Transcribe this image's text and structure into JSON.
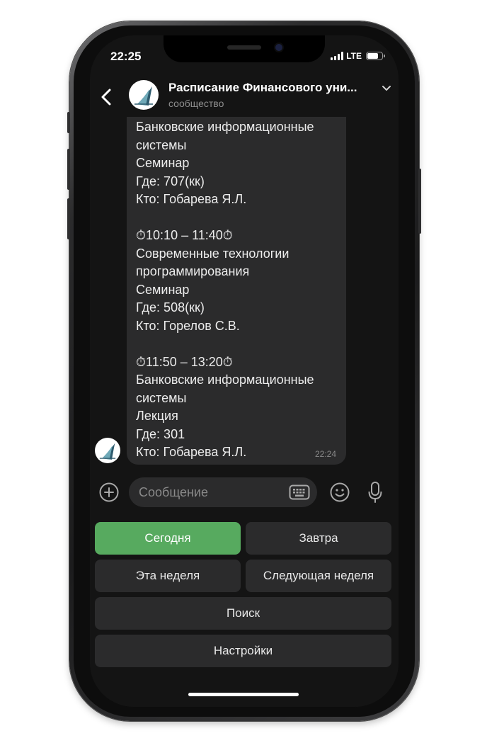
{
  "status_bar": {
    "time": "22:25",
    "network": "LTE",
    "battery_level": 0.75
  },
  "header": {
    "back_icon": "chevron-left-icon",
    "title": "Расписание Финансового уни...",
    "subtitle": "сообщество",
    "expand_icon": "chevron-down-icon"
  },
  "message": {
    "text": "Банковские информационные\nсистемы\nСеминар\nГде: 707(кк)\nКто: Гобарева Я.Л.\n\n⏱10:10 – 11:40⏱\nСовременные технологии\nпрограммирования\nСеминар\nГде: 508(кк)\nКто: Горелов С.В.\n\n⏱11:50 – 13:20⏱\nБанковские информационные\nсистемы\nЛекция\nГде: 301\nКто: Гобарева Я.Л.",
    "time": "22:24"
  },
  "composer": {
    "placeholder": "Сообщение",
    "icons": [
      "plus-icon",
      "keyboard-icon",
      "smile-icon",
      "mic-icon"
    ]
  },
  "keyboard": {
    "today": "Сегодня",
    "tomorrow": "Завтра",
    "this_week": "Эта неделя",
    "next_week": "Следующая неделя",
    "search": "Поиск",
    "settings": "Настройки"
  },
  "colors": {
    "accent": "#57aa5f",
    "bubble": "#2b2b2c",
    "background": "#141414"
  }
}
